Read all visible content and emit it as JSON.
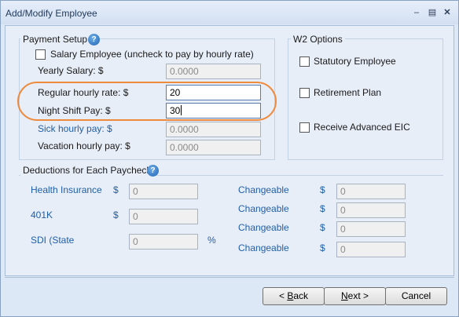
{
  "window": {
    "title": "Add/Modify Employee"
  },
  "payment_setup": {
    "title": "Payment Setup",
    "help_glyph": "?",
    "salary_checkbox_label": "Salary Employee (uncheck to pay by hourly rate)",
    "salary_checked": false,
    "yearly_salary_label": "Yearly Salary: $",
    "yearly_salary_value": "0.0000",
    "regular_rate_label": "Regular hourly rate: $",
    "regular_rate_value": "20",
    "night_shift_label": "Night Shift Pay: $",
    "night_shift_value": "30",
    "sick_label": "Sick hourly pay: $",
    "sick_value": "0.0000",
    "vacation_label": "Vacation hourly pay: $",
    "vacation_value": "0.0000"
  },
  "w2_options": {
    "title": "W2 Options",
    "statutory_label": "Statutory Employee",
    "retirement_label": "Retirement Plan",
    "eic_label": "Receive Advanced EIC"
  },
  "deductions": {
    "title": "Deductions for Each Paycheck",
    "help_glyph": "?",
    "health_label": "Health Insurance",
    "health_currency": "$",
    "health_value": "0",
    "k401_label": "401K",
    "k401_currency": "$",
    "k401_value": "0",
    "sdi_label": "SDI (State",
    "sdi_value": "0",
    "sdi_unit": "%",
    "changeable": [
      {
        "label": "Changeable",
        "currency": "$",
        "value": "0"
      },
      {
        "label": "Changeable",
        "currency": "$",
        "value": "0"
      },
      {
        "label": "Changeable",
        "currency": "$",
        "value": "0"
      },
      {
        "label": "Changeable",
        "currency": "$",
        "value": "0"
      }
    ]
  },
  "buttons": {
    "back_prefix": "< ",
    "back_mnemonic": "B",
    "back_rest": "ack",
    "next_mnemonic": "N",
    "next_rest": "ext >",
    "cancel": "Cancel"
  },
  "colors": {
    "highlight_outline": "#ee8a3c",
    "link_label": "#1f5fa8"
  }
}
